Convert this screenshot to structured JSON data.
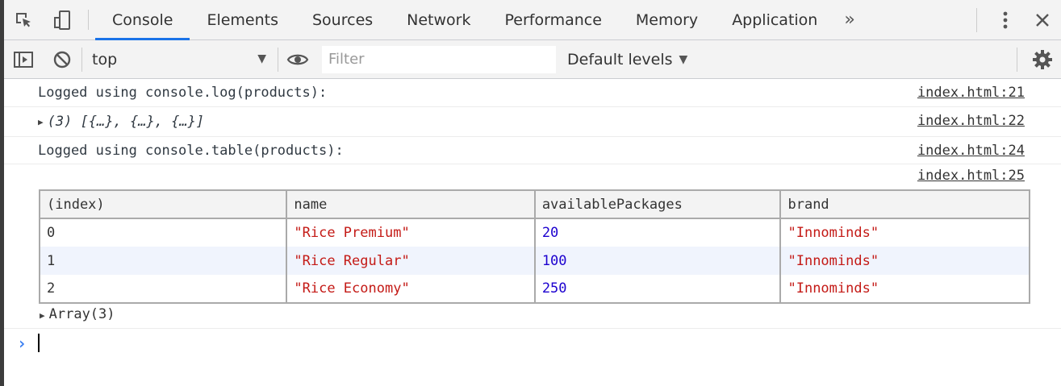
{
  "tabs": [
    "Console",
    "Elements",
    "Sources",
    "Network",
    "Performance",
    "Memory",
    "Application"
  ],
  "tabs_more": "»",
  "toolbar": {
    "context": "top",
    "filter_placeholder": "Filter",
    "levels": "Default levels"
  },
  "messages": [
    {
      "text": "Logged using console.log(products):",
      "source": "index.html:21"
    },
    {
      "text": "(3) [{…}, {…}, {…}]",
      "source": "index.html:22"
    },
    {
      "text": "Logged using console.table(products):",
      "source": "index.html:24"
    }
  ],
  "table": {
    "source": "index.html:25",
    "headers": [
      "(index)",
      "name",
      "availablePackages",
      "brand"
    ],
    "rows": [
      [
        "0",
        "\"Rice Premium\"",
        "20",
        "\"Innominds\""
      ],
      [
        "1",
        "\"Rice Regular\"",
        "100",
        "\"Innominds\""
      ],
      [
        "2",
        "\"Rice Economy\"",
        "250",
        "\"Innominds\""
      ]
    ],
    "footer": "Array(3)"
  },
  "colors": {
    "accent": "#1a73e8",
    "string": "#c41a16",
    "number": "#1c00cf",
    "prompt": "#367cf1"
  }
}
